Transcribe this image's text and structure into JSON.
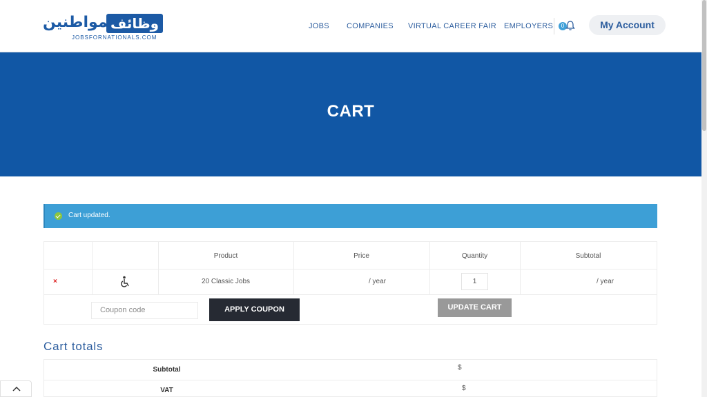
{
  "brand": {
    "arabic_part1": "للمواطنين",
    "arabic_part2": "وظائف",
    "latin": "JOBSFORNATIONALS.COM",
    "accent": "#1157a5"
  },
  "nav": {
    "items": [
      "JOBS",
      "COMPANIES",
      "VIRTUAL CAREER FAIR",
      "EMPLOYERS"
    ],
    "notification_count": "0",
    "account_label": "My Account"
  },
  "hero": {
    "title": "CART"
  },
  "notice": {
    "text": "Cart updated.",
    "icon": "check-circle-icon"
  },
  "cart": {
    "headers": [
      "Product",
      "Price",
      "Quantity",
      "Subtotal"
    ],
    "row": {
      "remove": "×",
      "product": "20 Classic Jobs",
      "price": "/ year",
      "quantity": "1",
      "subtotal": "/ year"
    },
    "coupon_placeholder": "Coupon code",
    "apply_label": "APPLY COUPON",
    "update_label": "UPDATE CART"
  },
  "totals": {
    "title": "Cart totals",
    "rows": [
      {
        "label": "Subtotal",
        "value": "$"
      },
      {
        "label": "VAT",
        "value": "$"
      }
    ]
  }
}
